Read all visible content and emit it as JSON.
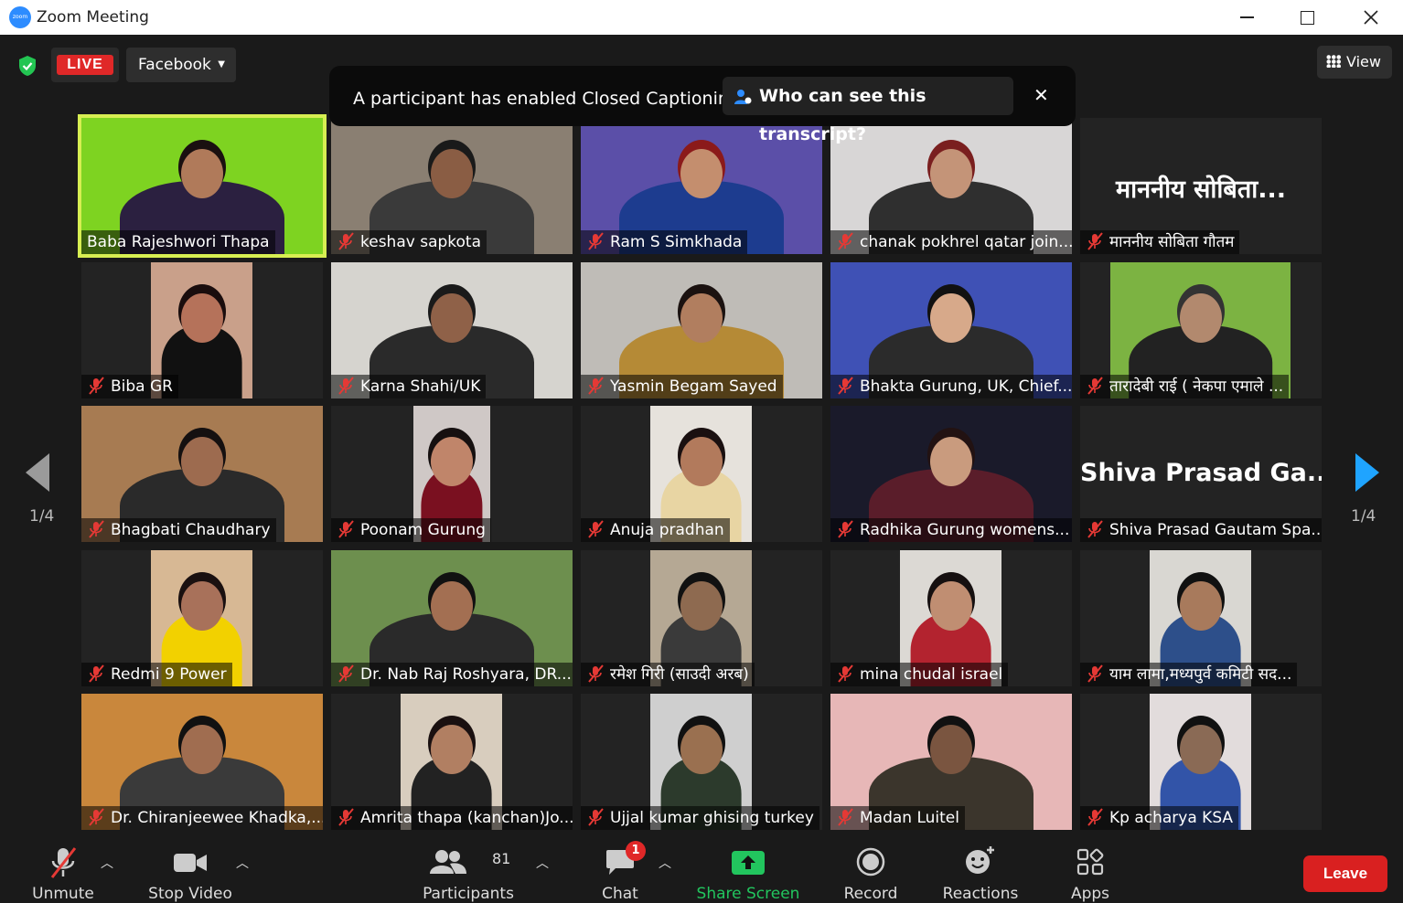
{
  "window": {
    "title": "Zoom Meeting",
    "logo_text": "zoom"
  },
  "top": {
    "live_label": "LIVE",
    "stream_target": "Facebook",
    "view_label": "View"
  },
  "caption": {
    "text": "A participant has enabled Closed Captioning",
    "who_label": "Who can see this transcript?"
  },
  "pager": {
    "left": "1/4",
    "right": "1/4"
  },
  "participants": [
    {
      "name": "Baba Rajeshwori Thapa",
      "muted": false,
      "active": true
    },
    {
      "name": "keshav sapkota",
      "muted": true
    },
    {
      "name": "Ram S Simkhada",
      "muted": true
    },
    {
      "name": "chanak pokhrel qatar join...",
      "muted": true
    },
    {
      "name": "माननीय सोबिता गौतम",
      "muted": true,
      "avatar_text": "माननीय सोबिता..."
    },
    {
      "name": "Biba GR",
      "muted": true
    },
    {
      "name": "Karna Shahi/UK",
      "muted": true
    },
    {
      "name": "Yasmin Begam Sayed",
      "muted": true
    },
    {
      "name": "Bhakta Gurung, UK, Chief...",
      "muted": true
    },
    {
      "name": "तारादेबी राई ( नेकपा एमाले ...",
      "muted": true
    },
    {
      "name": "Bhagbati Chaudhary",
      "muted": true
    },
    {
      "name": "Poonam Gurung",
      "muted": true
    },
    {
      "name": "Anuja pradhan",
      "muted": true
    },
    {
      "name": "Radhika Gurung womens...",
      "muted": true
    },
    {
      "name": "Shiva Prasad Gautam Spa...",
      "muted": true,
      "avatar_text": "Shiva Prasad Ga..."
    },
    {
      "name": "Redmi 9 Power",
      "muted": true
    },
    {
      "name": "Dr. Nab Raj Roshyara, DR...",
      "muted": true
    },
    {
      "name": "रमेश गिरी (साउदी अरब)",
      "muted": true
    },
    {
      "name": "mina chudal israel",
      "muted": true
    },
    {
      "name": "याम लामा,मध्यपुर्व कमिटी सद...",
      "muted": true
    },
    {
      "name": "Dr. Chiranjeewee Khadka,...",
      "muted": true
    },
    {
      "name": "Amrita thapa (kanchan)Jo...",
      "muted": true
    },
    {
      "name": "Ujjal kumar ghising  turkey",
      "muted": true
    },
    {
      "name": "Madan Luitel",
      "muted": true
    },
    {
      "name": "Kp acharya KSA",
      "muted": true
    }
  ],
  "toolbar": {
    "unmute": "Unmute",
    "stop_video": "Stop Video",
    "participants": "Participants",
    "participant_count": "81",
    "chat": "Chat",
    "chat_badge": "1",
    "share_screen": "Share Screen",
    "record": "Record",
    "reactions": "Reactions",
    "apps": "Apps",
    "leave": "Leave"
  }
}
